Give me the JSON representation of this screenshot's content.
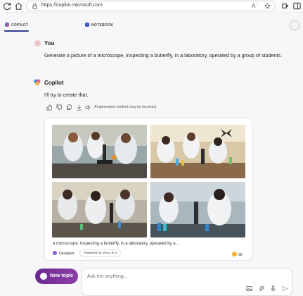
{
  "browser": {
    "url": "https://copilot.microsoft.com",
    "icons": [
      "refresh-icon",
      "home-icon",
      "lock-icon",
      "read-aloud-icon",
      "favorite-star-icon",
      "extensions-icon",
      "sidebar-icon"
    ],
    "read_aloud_glyph": "Aʾ"
  },
  "tabs": [
    {
      "label": "COPILOT",
      "active": true
    },
    {
      "label": "NOTEBOOK",
      "active": false
    }
  ],
  "top_right_text": "······ ··",
  "conversation": {
    "user": {
      "name": "You",
      "message": "Generate a picture of a microscope, inspecting a butterfly, in a laboratory, operated by a group of students."
    },
    "assistant": {
      "name": "Copilot",
      "message": "I'll try to create that.",
      "actions": [
        "thumbs-up-icon",
        "thumbs-down-icon",
        "copy-icon",
        "download-icon",
        "read-aloud-icon"
      ],
      "disclaimer": "AI-generated content may be incorrect"
    }
  },
  "image_card": {
    "caption": "a microscope, inspecting a butterfly, in a laboratory, operated by a...",
    "source_label": "Designer",
    "powered_by": "Powered by DALL·E 3",
    "boosts": "99"
  },
  "composer": {
    "new_topic_label": "New topic",
    "placeholder": "Ask me anything...",
    "icons": [
      "image-upload-icon",
      "attach-icon",
      "microphone-icon",
      "send-icon"
    ]
  },
  "colors": {
    "accent": "#2f3d8f",
    "new_topic_bg": "#7a3599",
    "page_bg": "#f7f7f9"
  }
}
